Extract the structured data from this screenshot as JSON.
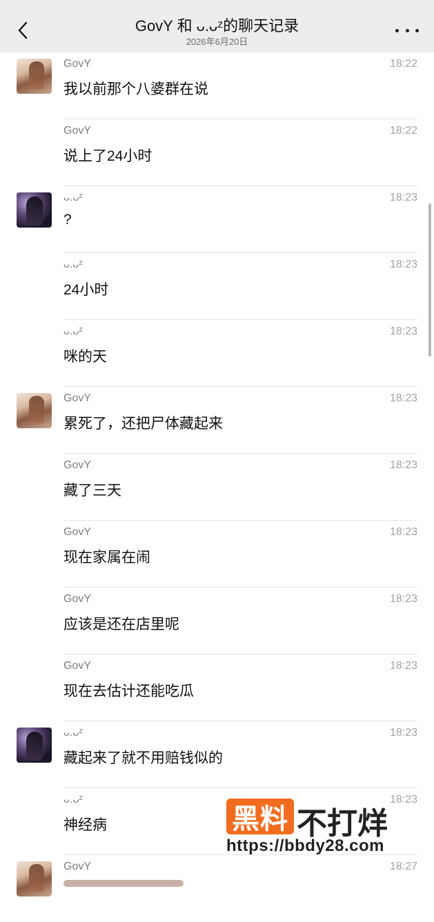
{
  "header": {
    "title": "GovY 和 ᴗ.ᴗᶻ的聊天记录",
    "date": "2026年6月20日"
  },
  "messages": [
    {
      "sender": "GovY",
      "time": "18:22",
      "text": "我以前那个八婆群在说",
      "avatar": "a"
    },
    {
      "sender": "GovY",
      "time": "18:22",
      "text": "说上了24小时",
      "avatar": ""
    },
    {
      "sender": "ᴗ.ᴗᶻ",
      "time": "18:23",
      "text": "?",
      "avatar": "b"
    },
    {
      "sender": "ᴗ.ᴗᶻ",
      "time": "18:23",
      "text": "24小时",
      "avatar": ""
    },
    {
      "sender": "ᴗ.ᴗᶻ",
      "time": "18:23",
      "text": "咪的天",
      "avatar": ""
    },
    {
      "sender": "GovY",
      "time": "18:23",
      "text": "累死了，还把尸体藏起来",
      "avatar": "a"
    },
    {
      "sender": "GovY",
      "time": "18:23",
      "text": "藏了三天",
      "avatar": ""
    },
    {
      "sender": "GovY",
      "time": "18:23",
      "text": "现在家属在闹",
      "avatar": ""
    },
    {
      "sender": "GovY",
      "time": "18:23",
      "text": "应该是还在店里呢",
      "avatar": ""
    },
    {
      "sender": "GovY",
      "time": "18:23",
      "text": "现在去估计还能吃瓜",
      "avatar": ""
    },
    {
      "sender": "ᴗ.ᴗᶻ",
      "time": "18:23",
      "text": "藏起来了就不用赔钱似的",
      "avatar": "b"
    },
    {
      "sender": "ᴗ.ᴗᶻ",
      "time": "18:23",
      "text": "神经病",
      "avatar": ""
    },
    {
      "sender": "GovY",
      "time": "18:27",
      "text": "",
      "avatar": "a"
    }
  ],
  "watermark": {
    "badge": "黑料",
    "text": "不打烊",
    "url": "https://bbdy28.com"
  }
}
